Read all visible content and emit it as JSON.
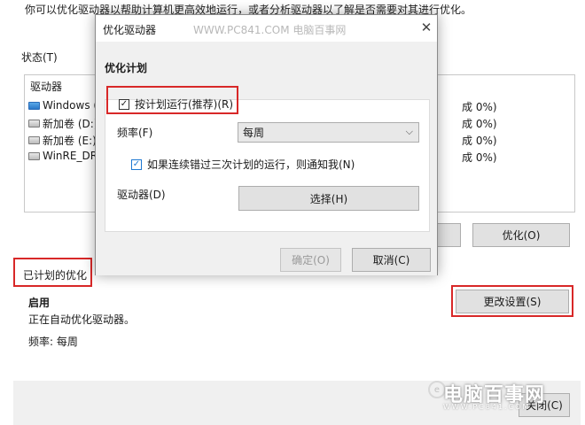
{
  "background": {
    "description_text": "你可以优化驱动器以帮助计算机更高效地运行，或者分析驱动器以了解是否需要对其进行优化。",
    "status_label": "状态(T)",
    "drive_list": {
      "header": "驱动器",
      "rows": [
        {
          "name": "Windows (C",
          "status": "成 0%)"
        },
        {
          "name": "新加卷 (D:)",
          "status": "成 0%)"
        },
        {
          "name": "新加卷 (E:)",
          "status": "成 0%)"
        },
        {
          "name": "WinRE_DRV",
          "status": "成 0%)"
        }
      ]
    },
    "optimize_button": "优化(O)",
    "scheduled": {
      "title": "已计划的优化",
      "enabled": "启用",
      "auto_text": "正在自动优化驱动器。",
      "frequency": "频率: 每周"
    },
    "change_settings_button": "更改设置(S)",
    "close_button": "关闭(C)"
  },
  "dialog": {
    "title": "优化驱动器",
    "watermark": "WWW.PC841.COM 电脑百事网",
    "heading": "优化计划",
    "run_on_schedule": {
      "label": "按计划运行(推荐)(R)",
      "checked": true
    },
    "frequency_label": "频率(F)",
    "frequency_value": "每周",
    "notify": {
      "label": "如果连续错过三次计划的运行，则通知我(N)",
      "checked": true
    },
    "drives_label": "驱动器(D)",
    "choose_button": "选择(H)",
    "ok_button": "确定(O)",
    "cancel_button": "取消(C)"
  },
  "watermark": {
    "logo_text": "电脑百事网",
    "url_text": "WWW.PC841.COM"
  },
  "colors": {
    "highlight_red": "#d82828",
    "checkbox_blue": "#1e78d2",
    "window_bg": "#f0f0f0"
  }
}
